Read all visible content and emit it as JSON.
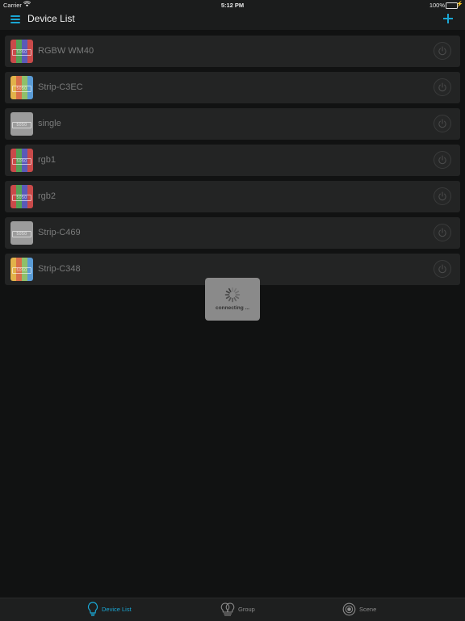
{
  "status_bar": {
    "carrier": "Carrier",
    "time": "5:12 PM",
    "battery": "100%"
  },
  "nav": {
    "title": "Device List",
    "menu_icon": "hamburger-menu-icon",
    "add_icon": "plus-icon",
    "accent": "#1aa6d3"
  },
  "devices": [
    {
      "name": "RGBW WM40",
      "icon": "rgb-strip-icon",
      "palette": [
        "#c94a4a",
        "#55a055",
        "#5a5ab8",
        "#c94a4a"
      ]
    },
    {
      "name": "Strip-C3EC",
      "icon": "multicolor-strip-icon",
      "palette": [
        "#e2b24a",
        "#d96f4a",
        "#8fbf6a",
        "#5a9bd5"
      ]
    },
    {
      "name": "single",
      "icon": "single-color-strip-icon",
      "palette": [
        "#9c9c9c",
        "#9c9c9c",
        "#9c9c9c",
        "#9c9c9c"
      ]
    },
    {
      "name": "rgb1",
      "icon": "rgb-strip-icon",
      "palette": [
        "#c94a4a",
        "#55a055",
        "#5a5ab8",
        "#c94a4a"
      ]
    },
    {
      "name": "rgb2",
      "icon": "rgb-strip-icon",
      "palette": [
        "#c94a4a",
        "#55a055",
        "#5a5ab8",
        "#c94a4a"
      ]
    },
    {
      "name": "Strip-C469",
      "icon": "single-color-strip-icon",
      "palette": [
        "#9c9c9c",
        "#9c9c9c",
        "#9c9c9c",
        "#9c9c9c"
      ]
    },
    {
      "name": "Strip-C348",
      "icon": "multicolor-strip-icon",
      "palette": [
        "#e2b24a",
        "#d96f4a",
        "#8fbf6a",
        "#5a9bd5"
      ]
    }
  ],
  "strip_icon_text": "5050",
  "hud": {
    "text": "connecting ..."
  },
  "tabs": [
    {
      "label": "Device List",
      "icon": "bulb-icon",
      "active": true
    },
    {
      "label": "Group",
      "icon": "group-bulbs-icon",
      "active": false
    },
    {
      "label": "Scene",
      "icon": "scene-icon",
      "active": false
    }
  ]
}
